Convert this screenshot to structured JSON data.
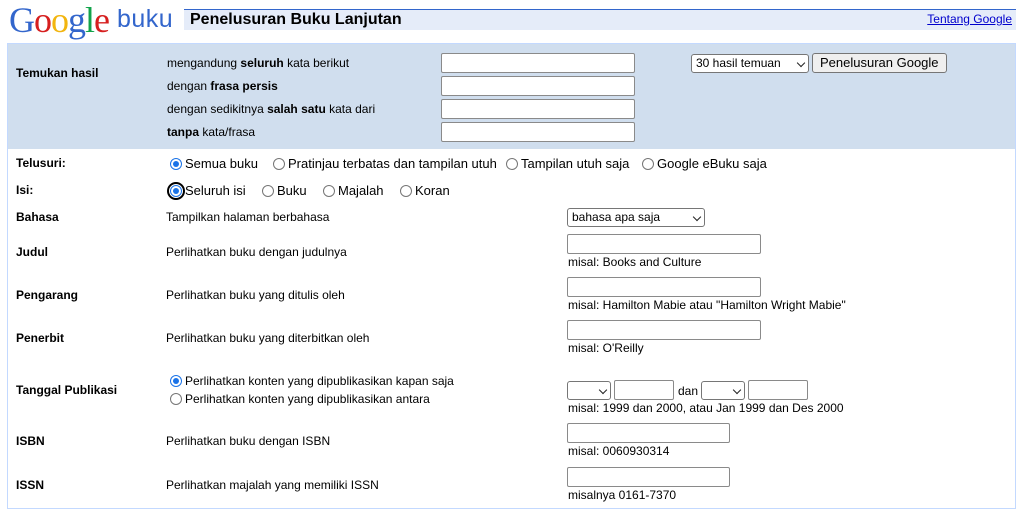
{
  "logo": {
    "letters": [
      "G",
      "o",
      "o",
      "g",
      "l",
      "e"
    ],
    "product": "buku"
  },
  "header": {
    "title": "Penelusuran Buku Lanjutan",
    "about_link": "Tentang Google"
  },
  "find": {
    "label": "Temukan hasil",
    "rows": [
      {
        "pre": "mengandung ",
        "bold": "seluruh",
        "post": " kata berikut",
        "value": ""
      },
      {
        "pre": "dengan ",
        "bold": "frasa persis",
        "post": "",
        "value": ""
      },
      {
        "pre": "dengan sedikitnya ",
        "bold": "salah satu",
        "post": " kata dari",
        "value": ""
      },
      {
        "pre": "",
        "bold": "tanpa",
        "post": " kata/frasa",
        "value": ""
      }
    ],
    "results_select": "30 hasil temuan",
    "search_button": "Penelusuran Google"
  },
  "browse": {
    "label": "Telusuri:",
    "options": [
      "Semua buku",
      "Pratinjau terbatas dan tampilan utuh",
      "Tampilan utuh saja",
      "Google eBuku saja"
    ],
    "selected": 0
  },
  "content": {
    "label": "Isi:",
    "options": [
      "Seluruh isi",
      "Buku",
      "Majalah",
      "Koran"
    ],
    "selected": 0
  },
  "language": {
    "label": "Bahasa",
    "desc": "Tampilkan halaman berbahasa",
    "select": "bahasa apa saja"
  },
  "title_field": {
    "label": "Judul",
    "desc": "Perlihatkan buku dengan judulnya",
    "hint": "misal: Books and Culture",
    "value": ""
  },
  "author": {
    "label": "Pengarang",
    "desc": "Perlihatkan buku yang ditulis oleh",
    "hint": "misal: Hamilton Mabie atau \"Hamilton Wright Mabie\"",
    "value": ""
  },
  "publisher": {
    "label": "Penerbit",
    "desc": "Perlihatkan buku yang diterbitkan oleh",
    "hint": "misal: O'Reilly",
    "value": ""
  },
  "pubdate": {
    "label": "Tanggal Publikasi",
    "options": [
      "Perlihatkan konten yang dipublikasikan kapan saja",
      "Perlihatkan konten yang dipublikasikan antara"
    ],
    "selected": 0,
    "and": "dan",
    "hint": "misal: 1999 dan 2000, atau Jan 1999 dan Des 2000"
  },
  "isbn": {
    "label": "ISBN",
    "desc": "Perlihatkan buku dengan ISBN",
    "hint": "misal: 0060930314",
    "value": ""
  },
  "issn": {
    "label": "ISSN",
    "desc": "Perlihatkan majalah yang memiliki ISSN",
    "hint": "misalnya 0161-7370",
    "value": ""
  }
}
